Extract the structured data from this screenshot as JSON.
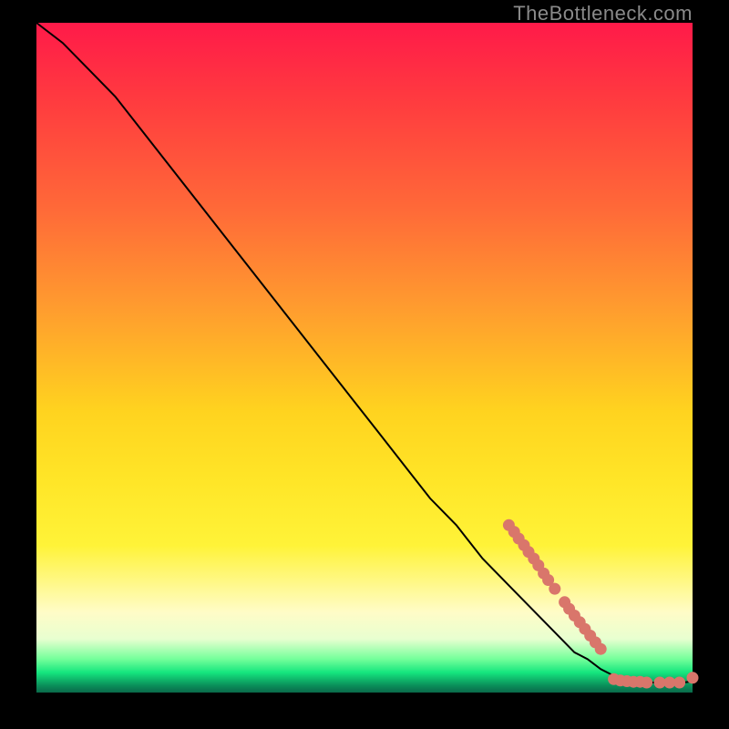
{
  "watermark": "TheBottleneck.com",
  "colors": {
    "line": "#000000",
    "marker_fill": "#d9766b",
    "marker_stroke": "#d9766b"
  },
  "chart_data": {
    "type": "line",
    "title": "",
    "xlabel": "",
    "ylabel": "",
    "xlim": [
      0,
      100
    ],
    "ylim": [
      0,
      100
    ],
    "grid": false,
    "legend": false,
    "series": [
      {
        "name": "curve",
        "x": [
          0,
          4,
          8,
          12,
          16,
          20,
          24,
          28,
          32,
          36,
          40,
          44,
          48,
          52,
          56,
          60,
          64,
          68,
          72,
          76,
          80,
          82,
          84,
          86,
          88,
          90,
          92,
          94,
          96,
          98,
          100
        ],
        "y": [
          100,
          97,
          93,
          89,
          84,
          79,
          74,
          69,
          64,
          59,
          54,
          49,
          44,
          39,
          34,
          29,
          25,
          20,
          16,
          12,
          8,
          6,
          5,
          3.5,
          2.5,
          2,
          1.7,
          1.5,
          1.4,
          1.4,
          1.7
        ]
      }
    ],
    "markers": [
      {
        "x": 72.0,
        "y": 25.0
      },
      {
        "x": 72.8,
        "y": 24.0
      },
      {
        "x": 73.5,
        "y": 23.0
      },
      {
        "x": 74.3,
        "y": 22.0
      },
      {
        "x": 75.0,
        "y": 21.0
      },
      {
        "x": 75.8,
        "y": 20.0
      },
      {
        "x": 76.5,
        "y": 19.0
      },
      {
        "x": 77.3,
        "y": 17.8
      },
      {
        "x": 78.0,
        "y": 16.8
      },
      {
        "x": 79.0,
        "y": 15.5
      },
      {
        "x": 80.5,
        "y": 13.5
      },
      {
        "x": 81.2,
        "y": 12.5
      },
      {
        "x": 82.0,
        "y": 11.5
      },
      {
        "x": 82.8,
        "y": 10.5
      },
      {
        "x": 83.6,
        "y": 9.5
      },
      {
        "x": 84.4,
        "y": 8.5
      },
      {
        "x": 85.2,
        "y": 7.5
      },
      {
        "x": 86.0,
        "y": 6.5
      },
      {
        "x": 88.0,
        "y": 2.0
      },
      {
        "x": 89.0,
        "y": 1.8
      },
      {
        "x": 90.0,
        "y": 1.7
      },
      {
        "x": 91.0,
        "y": 1.6
      },
      {
        "x": 92.0,
        "y": 1.6
      },
      {
        "x": 93.0,
        "y": 1.5
      },
      {
        "x": 95.0,
        "y": 1.5
      },
      {
        "x": 96.5,
        "y": 1.5
      },
      {
        "x": 98.0,
        "y": 1.5
      },
      {
        "x": 100.0,
        "y": 2.2
      }
    ]
  }
}
